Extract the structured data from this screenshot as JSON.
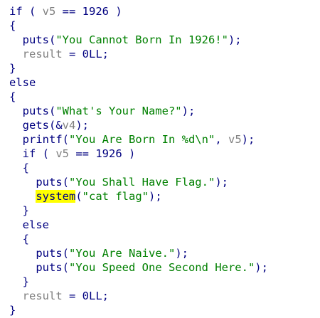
{
  "code_lines": [
    [
      {
        "t": "if",
        "c": "plain"
      },
      {
        "t": " ( ",
        "c": "plain"
      },
      {
        "t": "v5",
        "c": "var"
      },
      {
        "t": " == 1926 )",
        "c": "plain"
      }
    ],
    [
      {
        "t": "{",
        "c": "plain"
      }
    ],
    [
      {
        "t": "  puts(",
        "c": "plain"
      },
      {
        "t": "\"You Cannot Born In 1926!\"",
        "c": "str"
      },
      {
        "t": ");",
        "c": "plain"
      }
    ],
    [
      {
        "t": "  ",
        "c": "plain"
      },
      {
        "t": "result",
        "c": "var"
      },
      {
        "t": " = 0LL;",
        "c": "plain"
      }
    ],
    [
      {
        "t": "}",
        "c": "plain"
      }
    ],
    [
      {
        "t": "else",
        "c": "plain"
      }
    ],
    [
      {
        "t": "{",
        "c": "plain"
      }
    ],
    [
      {
        "t": "  puts(",
        "c": "plain"
      },
      {
        "t": "\"What's Your Name?\"",
        "c": "str"
      },
      {
        "t": ");",
        "c": "plain"
      }
    ],
    [
      {
        "t": "  gets(&",
        "c": "plain"
      },
      {
        "t": "v4",
        "c": "var"
      },
      {
        "t": ");",
        "c": "plain"
      }
    ],
    [
      {
        "t": "  printf(",
        "c": "plain"
      },
      {
        "t": "\"You Are Born In %d\\n\"",
        "c": "str"
      },
      {
        "t": ", ",
        "c": "plain"
      },
      {
        "t": "v5",
        "c": "var"
      },
      {
        "t": ");",
        "c": "plain"
      }
    ],
    [
      {
        "t": "  if ( ",
        "c": "plain"
      },
      {
        "t": "v5",
        "c": "var"
      },
      {
        "t": " == 1926 )",
        "c": "plain"
      }
    ],
    [
      {
        "t": "  {",
        "c": "plain"
      }
    ],
    [
      {
        "t": "    puts(",
        "c": "plain"
      },
      {
        "t": "\"You Shall Have Flag.\"",
        "c": "str"
      },
      {
        "t": ");",
        "c": "plain"
      }
    ],
    [
      {
        "t": "    ",
        "c": "plain"
      },
      {
        "t": "system",
        "c": "plain hl"
      },
      {
        "t": "(",
        "c": "plain"
      },
      {
        "t": "\"cat flag\"",
        "c": "str"
      },
      {
        "t": ");",
        "c": "plain"
      }
    ],
    [
      {
        "t": "  }",
        "c": "plain"
      }
    ],
    [
      {
        "t": "  else",
        "c": "plain"
      }
    ],
    [
      {
        "t": "  {",
        "c": "plain"
      }
    ],
    [
      {
        "t": "    puts(",
        "c": "plain"
      },
      {
        "t": "\"You Are Naive.\"",
        "c": "str"
      },
      {
        "t": ");",
        "c": "plain"
      }
    ],
    [
      {
        "t": "    puts(",
        "c": "plain"
      },
      {
        "t": "\"You Speed One Second Here.\"",
        "c": "str"
      },
      {
        "t": ");",
        "c": "plain"
      }
    ],
    [
      {
        "t": "  }",
        "c": "plain"
      }
    ],
    [
      {
        "t": "  ",
        "c": "plain"
      },
      {
        "t": "result",
        "c": "var"
      },
      {
        "t": " = 0LL;",
        "c": "plain"
      }
    ],
    [
      {
        "t": "}",
        "c": "plain"
      }
    ]
  ]
}
